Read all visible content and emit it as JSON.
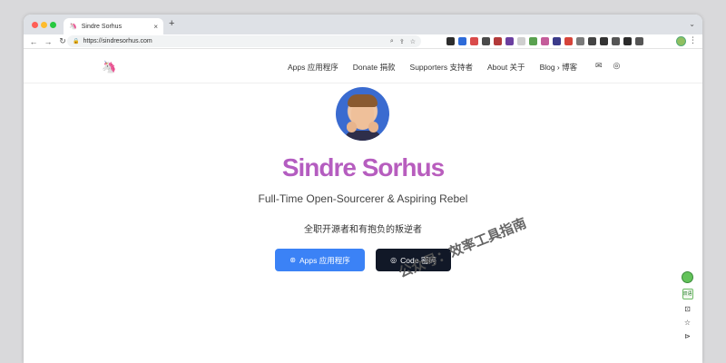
{
  "browser": {
    "tab_title": "Sindre Sorhus",
    "tab_close": "×",
    "new_tab": "+",
    "tab_menu": "⌄",
    "url": "https://sindresorhus.com",
    "back": "←",
    "forward": "→",
    "reload": "↻",
    "lock": "🔒",
    "omni_icons": [
      "⌕",
      "⇪",
      "☆"
    ],
    "kebab": "⋮",
    "extension_colors": [
      "#2d2d2d",
      "#2e6bd9",
      "#d94a4a",
      "#4a4a4a",
      "#b33a3a",
      "#6b3fa0",
      "#cfcfcf",
      "#59a14f",
      "#c45c9a",
      "#3b3b8a",
      "#d6443a",
      "#7a7a7a",
      "#444",
      "#333",
      "#555",
      "#2b2b2b",
      "#555"
    ]
  },
  "header": {
    "logo": "🦄",
    "nav": [
      "Apps  应用程序",
      "Donate  捐款",
      "Supporters  支持者",
      "About  关于",
      "Blog ›  博客"
    ],
    "mail_icon": "✉",
    "github_icon": "◎"
  },
  "hero": {
    "name": "Sindre Sorhus",
    "tagline": "Full-Time Open-Sourcerer & Aspiring Rebel",
    "tagline_cn": "全职开源者和有抱负的叛逆者",
    "apps_button": "Apps  应用程序",
    "apps_icon": "⊛",
    "code_button": "Code  密码",
    "code_icon": "◎"
  },
  "watermark": "公众号：效率工具指南",
  "dock": {
    "translate_label": "双语",
    "icons": [
      "⊡",
      "☆",
      "⊳"
    ]
  },
  "colors": {
    "accent_purple": "#b45fc0",
    "apps_button": "#3b82f6",
    "code_button": "#111827"
  }
}
